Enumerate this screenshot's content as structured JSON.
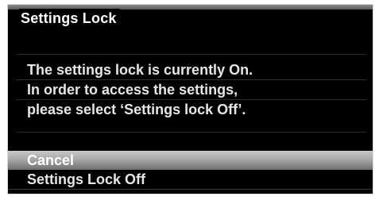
{
  "dialog": {
    "title": "Settings Lock",
    "message_lines": [
      "The settings lock is currently On.",
      "In order to access the settings,",
      "please select ‘Settings lock Off’."
    ],
    "options": [
      {
        "label": "Cancel",
        "selected": true
      },
      {
        "label": "Settings Lock Off",
        "selected": false
      }
    ]
  },
  "colors": {
    "background": "#000000",
    "text": "#e6e6e6",
    "highlight": "#a8a8a8"
  }
}
